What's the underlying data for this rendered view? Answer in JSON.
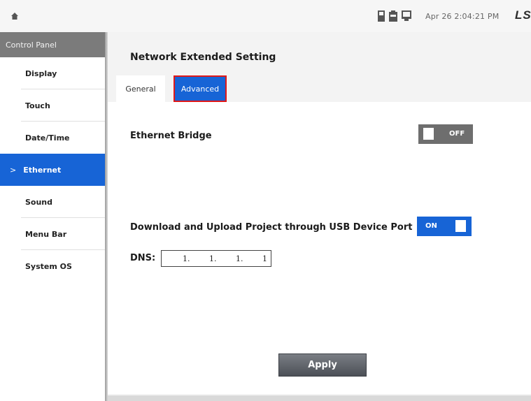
{
  "header": {
    "clock": "Apr 26 2:04:21 PM",
    "logo": "LS",
    "icons": [
      "home-icon",
      "sd-card-icon",
      "usb-icon",
      "monitor-icon"
    ]
  },
  "sidebar": {
    "title": "Control Panel",
    "items": [
      {
        "label": "Display"
      },
      {
        "label": "Touch"
      },
      {
        "label": "Date/Time"
      },
      {
        "label": "Ethernet",
        "active": true,
        "marker": ">"
      },
      {
        "label": "Sound"
      },
      {
        "label": "Menu Bar"
      },
      {
        "label": "System OS"
      }
    ]
  },
  "main": {
    "title": "Network Extended Setting",
    "tabs": [
      {
        "label": "General"
      },
      {
        "label": "Advanced",
        "selected": true
      }
    ],
    "ethernet_bridge": {
      "label": "Ethernet Bridge",
      "state": "OFF"
    },
    "usb_transfer": {
      "label": "Download and Upload Project through USB Device Port",
      "state": "ON"
    },
    "dns": {
      "label": "DNS:",
      "octets": [
        "1.",
        "1.",
        "1.",
        "1"
      ]
    },
    "apply_label": "Apply"
  },
  "colors": {
    "accent": "#1764d6",
    "highlight": "#e01818",
    "toggle_off": "#6e6e6e",
    "sidebar_header": "#7b7b7b"
  }
}
